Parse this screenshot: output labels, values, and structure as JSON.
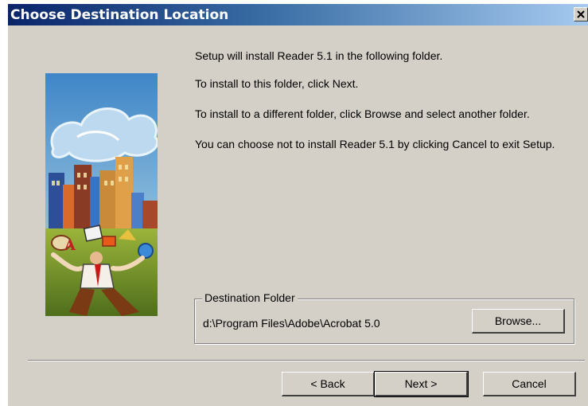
{
  "window": {
    "title": "Choose Destination Location",
    "close_label": "×"
  },
  "messages": {
    "line1": "Setup will install Reader 5.1 in the following folder.",
    "line2": "To install to this folder, click Next.",
    "line3": "To install to a different folder, click Browse and select another folder.",
    "line4": "You can choose not to install Reader 5.1 by clicking Cancel to exit Setup."
  },
  "destination": {
    "group_label": "Destination Folder",
    "path": "d:\\Program Files\\Adobe\\Acrobat 5.0",
    "browse_label": "Browse..."
  },
  "buttons": {
    "back_label": "< Back",
    "next_label": "Next >",
    "cancel_label": "Cancel"
  },
  "colors": {
    "titlebar_start": "#0a246a",
    "titlebar_end": "#a6caf0",
    "dialog_face": "#d4d0c8"
  }
}
